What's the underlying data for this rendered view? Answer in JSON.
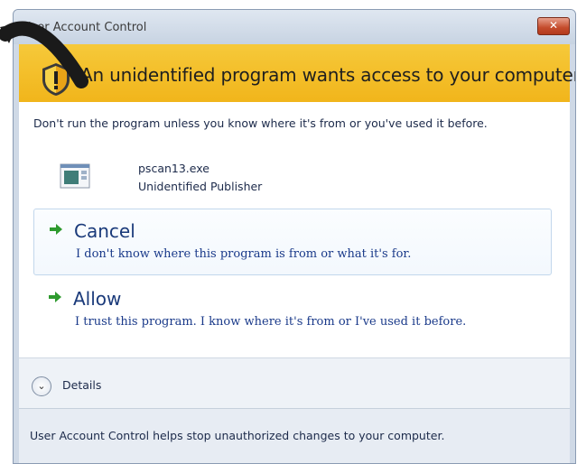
{
  "window": {
    "title": "User Account Control",
    "close_glyph": "✕"
  },
  "banner": {
    "heading": "An unidentified program wants access to your computer",
    "icon": "shield-warning-icon"
  },
  "content": {
    "warning": "Don't run the program unless you know where it's from or you've used it before.",
    "program": {
      "file_name": "pscan13.exe",
      "publisher": "Unidentified Publisher",
      "icon": "application-icon"
    },
    "options": [
      {
        "title": "Cancel",
        "description": "I don't know where this program is from or what it's for."
      },
      {
        "title": "Allow",
        "description": "I trust this program. I know where it's from or I've used it before."
      }
    ]
  },
  "details": {
    "label": "Details",
    "icon": "chevron-down-icon"
  },
  "footer": {
    "text": "User Account Control helps stop unauthorized changes to your computer."
  },
  "colors": {
    "banner": "#f1b51b",
    "option_arrow": "#2e9a2e",
    "link_text": "#1a3a7a"
  }
}
